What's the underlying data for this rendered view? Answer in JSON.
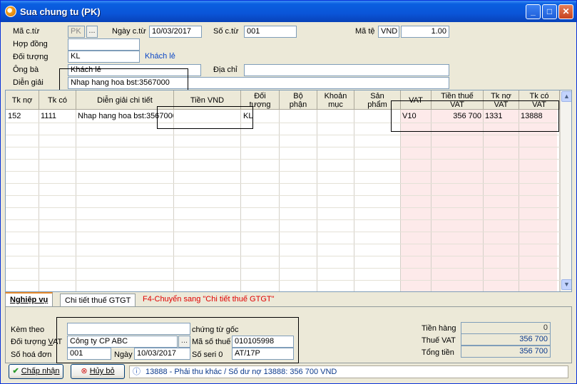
{
  "window": {
    "title": "Sua chung tu (PK)"
  },
  "header": {
    "ma_ct_label": "Mã c.từ",
    "ma_ct_value": "PK",
    "ma_ct_lookup": "...",
    "ngay_ct_label": "Ngày c.từ",
    "ngay_ct_value": "10/03/2017",
    "so_ct_label": "Số c.từ",
    "so_ct_value": "001",
    "ma_te_label": "Mã tệ",
    "ma_te_value": "VND",
    "ty_gia_value": "1.00",
    "hop_dong_label": "Hợp đồng",
    "hop_dong_value": "",
    "doi_tuong_label": "Đối tượng",
    "doi_tuong_value": "KL",
    "doi_tuong_name": "Khách lẻ",
    "ong_ba_label": "Ông bà",
    "ong_ba_value": "Khách lẻ",
    "dia_chi_label": "Địa chỉ",
    "dia_chi_value": "",
    "dien_giai_label": "Diễn giải",
    "dien_giai_value": "Nhap hang hoa bst:3567000"
  },
  "grid": {
    "columns": [
      "Tk nợ",
      "Tk có",
      "Diễn giải chi tiết",
      "Tiền VND",
      "Đối tượng",
      "Bộ phận",
      "Khoản mục",
      "Sản phẩm",
      "VAT",
      "Tiền thuế VAT",
      "Tk nợ VAT",
      "Tk có VAT"
    ],
    "rows": [
      {
        "tk_no": "152",
        "tk_co": "1111",
        "dien_giai": "Nhap hang hoa bst:3567000",
        "tien": "",
        "doi_tuong": "KL",
        "bo_phan": "",
        "khoan_muc": "",
        "san_pham": "",
        "vat": "V10",
        "tien_thue": "356 700",
        "tk_no_vat": "1331",
        "tk_co_vat": "13888"
      }
    ]
  },
  "tabs": {
    "tab1": "Nghiệp vụ",
    "tab2": "Chi tiết thuế GTGT",
    "hint": "F4-Chuyển sang \"Chi tiết thuế GTGT\""
  },
  "bottom": {
    "kem_theo_label": "Kèm theo",
    "kem_theo_value": "",
    "chung_tu_goc_label": "chứng từ gốc",
    "doi_tuong_vat_label": "Đối tượng VAT",
    "doi_tuong_vat_value": "Công ty CP ABC",
    "doi_tuong_vat_lookup": "...",
    "ma_so_thue_label": "Mã số thuế",
    "ma_so_thue_value": "010105998",
    "so_hoa_don_label": "Số hoá đơn",
    "so_hoa_don_value": "001",
    "ngay_label": "Ngày",
    "ngay_value": "10/03/2017",
    "so_seri_label": "Số seri 0",
    "so_seri_value": "AT/17P",
    "tien_hang_label": "Tiền hàng",
    "tien_hang_value": "0",
    "thue_vat_label": "Thuế VAT",
    "thue_vat_value": "356 700",
    "tong_tien_label": "Tổng tiền",
    "tong_tien_value": "356 700"
  },
  "buttons": {
    "accept": "Chấp nhận",
    "cancel": "Hủy bỏ"
  },
  "status": {
    "text": "13888 - Phải thu khác / Số dư nợ 13888: 356 700 VND"
  },
  "colors": {
    "titlebar": "#0a55d8",
    "vat_column_bg": "#fdeaea",
    "hint_red": "#e00000",
    "link_blue": "#0c47c6"
  }
}
